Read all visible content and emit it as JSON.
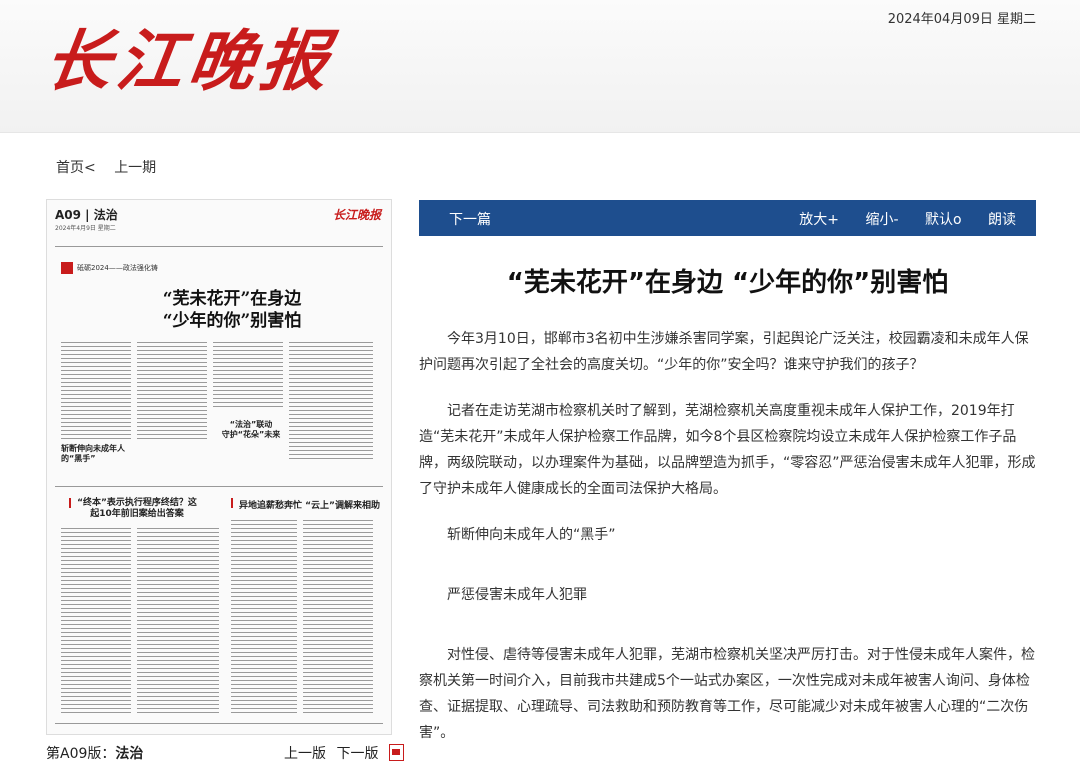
{
  "masthead": {
    "logo_text": "长江晚报",
    "date": "2024年04月09日 星期二"
  },
  "nav": {
    "home": "首页<",
    "prev_issue": "上一期"
  },
  "thumb": {
    "page_label": "A09 | 法治",
    "page_sub": "2024年4月9日 星期二",
    "mini_logo": "长江晚报",
    "tag_text": "砥砺2024——政法强化铸",
    "title_line1": "“芜未花开”在身边",
    "title_line2": "“少年的你”别害怕",
    "sub_a": "斩断伸向未成年人的“黑手”",
    "sub_b": "“法治”联动",
    "sub_c": "守护“花朵”未来",
    "story2_title": "“终本”表示执行程序终结？这起10年前旧案给出答案",
    "story3_title": "异地追薪愁奔忙 “云上”调解来相助"
  },
  "edition": {
    "label": "第A09版：",
    "name": "法治"
  },
  "page_nav": {
    "prev": "上一版",
    "next": "下一版"
  },
  "toolbar": {
    "next_label": "下一篇",
    "zoom_in": "放大+",
    "zoom_out": "缩小-",
    "default": "默认o",
    "read_aloud": "朗读"
  },
  "article": {
    "title": "“芜未花开”在身边 “少年的你”别害怕",
    "paragraphs": [
      "今年3月10日，邯郸市3名初中生涉嫌杀害同学案，引起舆论广泛关注，校园霸凌和未成年人保护问题再次引起了全社会的高度关切。“少年的你”安全吗？谁来守护我们的孩子？",
      "记者在走访芜湖市检察机关时了解到，芜湖检察机关高度重视未成年人保护工作，2019年打造“芜未花开”未成年人保护检察工作品牌，如今8个县区检察院均设立未成年人保护检察工作子品牌，两级院联动，以办理案件为基础，以品牌塑造为抓手，“零容忍”严惩治侵害未成年人犯罪，形成了守护未成年人健康成长的全面司法保护大格局。",
      "斩断伸向未成年人的“黑手”",
      "严惩侵害未成年人犯罪",
      "对性侵、虐待等侵害未成年人犯罪，芜湖市检察机关坚决严厉打击。对于性侵未成年人案件，检察机关第一时间介入，目前我市共建成5个一站式办案区，一次性完成对未成年被害人询问、身体检查、证据提取、心理疏导、司法救助和预防教育等工作，尽可能减少对未成年被害人心理的“二次伤害”。"
    ]
  }
}
